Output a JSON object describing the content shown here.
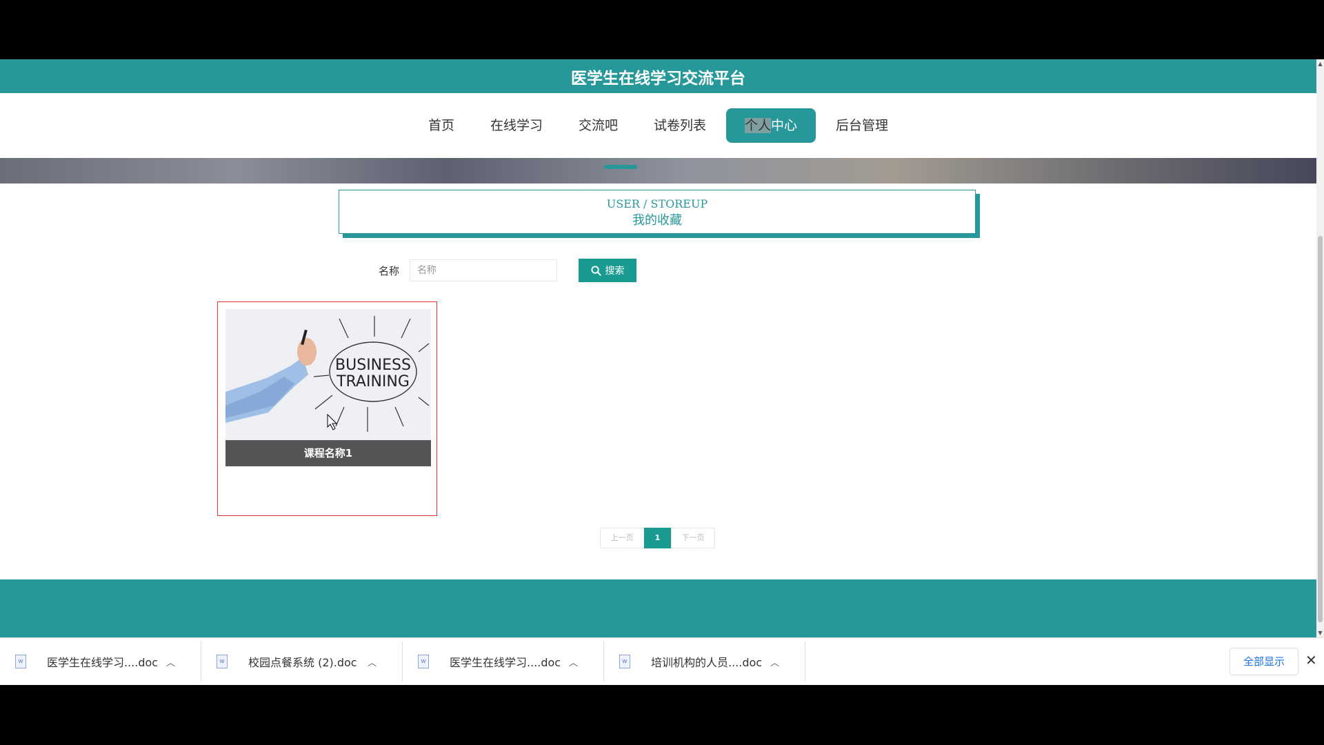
{
  "site": {
    "title": "医学生在线学习交流平台"
  },
  "nav": {
    "items": [
      {
        "label": "首页"
      },
      {
        "label": "在线学习"
      },
      {
        "label": "交流吧"
      },
      {
        "label": "试卷列表"
      },
      {
        "label": "个人中心",
        "selected_part": "个人",
        "rest_part": "中心",
        "active": true
      },
      {
        "label": "后台管理"
      }
    ]
  },
  "section": {
    "title_en": "USER / STOREUP",
    "title_cn": "我的收藏"
  },
  "search": {
    "label": "名称",
    "placeholder": "名称",
    "value": "",
    "button_label": "搜索"
  },
  "cards": [
    {
      "name": "课程名称1",
      "image_text_line1": "BUSINESS",
      "image_text_line2": "TRAINING"
    }
  ],
  "pagination": {
    "prev": "上一页",
    "current": "1",
    "next": "下一页"
  },
  "downloads": [
    {
      "name": "医学生在线学习....doc"
    },
    {
      "name": "校园点餐系统 (2).doc"
    },
    {
      "name": "医学生在线学习....doc"
    },
    {
      "name": "培训机构的人员....doc"
    }
  ],
  "download_bar": {
    "show_all": "全部显示"
  },
  "colors": {
    "accent": "#27989a",
    "button": "#1a9b91",
    "card_border": "#e03030"
  }
}
